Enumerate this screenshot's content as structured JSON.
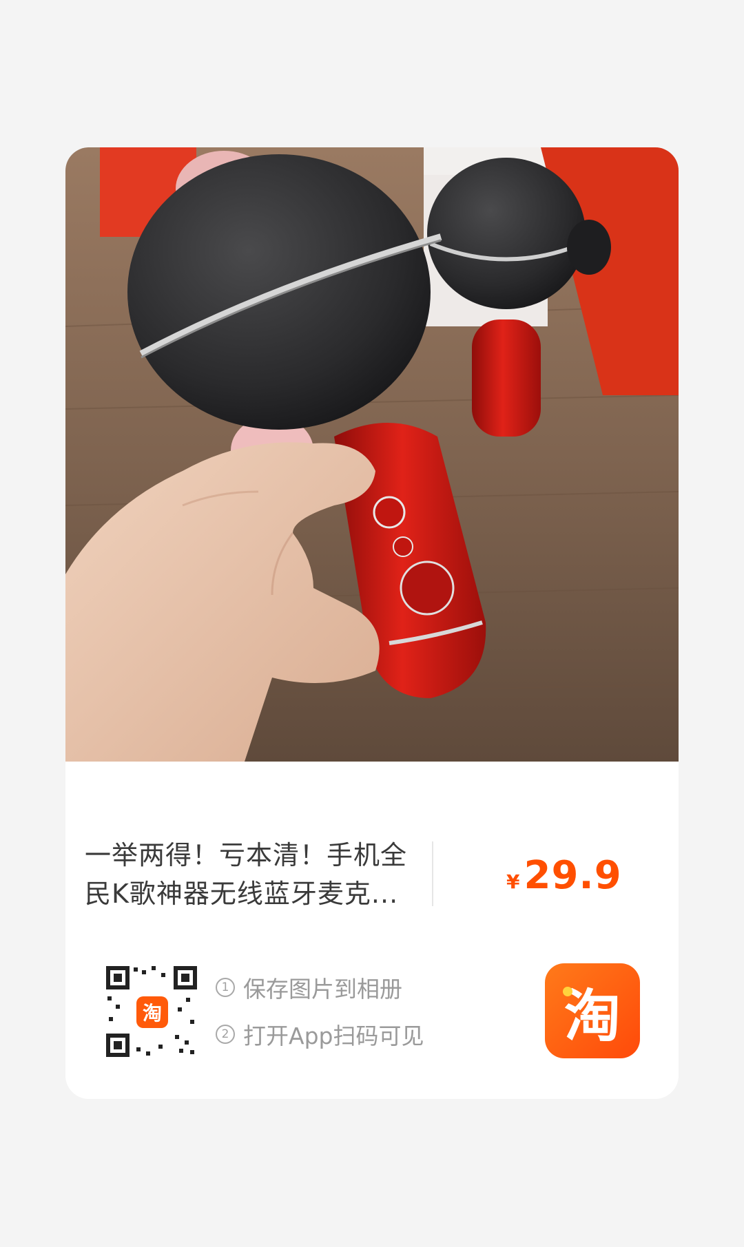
{
  "product": {
    "title": "一举两得！亏本清！手机全民K歌神器无线蓝牙麦克...",
    "currency_symbol": "¥",
    "price": "29.9"
  },
  "share": {
    "step1_number": "①",
    "step1_text": "保存图片到相册",
    "step2_number": "②",
    "step2_text": "打开App扫码可见",
    "qr_badge_text": "淘",
    "app_logo_text": "淘"
  },
  "colors": {
    "accent": "#ff4f00",
    "logo": "#ff5a0a",
    "background": "#f4f4f4",
    "card": "#ffffff"
  },
  "icons": {
    "app_logo": "taobao-logo-icon",
    "qr": "qr-code-icon"
  }
}
